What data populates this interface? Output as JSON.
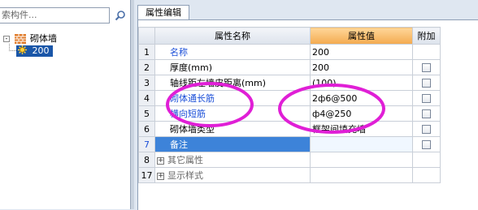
{
  "left_panel": {
    "search_placeholder": "索构件...",
    "tree": {
      "root_label": "砌体墙",
      "child_label": "200"
    }
  },
  "right_panel": {
    "tab_label": "属性编辑",
    "columns": {
      "num": "",
      "name": "属性名称",
      "value": "属性值",
      "extra": "附加"
    },
    "rows": [
      {
        "num": "1",
        "name": "名称",
        "value": "200",
        "style": "blue",
        "checkbox": false
      },
      {
        "num": "2",
        "name": "厚度(mm)",
        "value": "200",
        "style": "normal",
        "checkbox": true
      },
      {
        "num": "3",
        "name": "轴线距左墙皮距离(mm)",
        "value": "(100)",
        "style": "normal",
        "checkbox": true
      },
      {
        "num": "4",
        "name": "砌体通长筋",
        "value": "2ф6@500",
        "style": "blue",
        "checkbox": true
      },
      {
        "num": "5",
        "name": "横向短筋",
        "value": "ф4@250",
        "style": "blue",
        "checkbox": true
      },
      {
        "num": "6",
        "name": "砌体墙类型",
        "value": "框架间填充墙",
        "style": "normal",
        "checkbox": true
      },
      {
        "num": "7",
        "name": "备注",
        "value": "",
        "style": "selected",
        "checkbox": true
      },
      {
        "num": "8",
        "name": "其它属性",
        "value": "",
        "style": "group",
        "checkbox": false
      },
      {
        "num": "17",
        "name": "显示样式",
        "value": "",
        "style": "group",
        "checkbox": false
      }
    ]
  },
  "icons": {
    "search": "search-icon",
    "wall": "wall-icon",
    "gear": "gear-icon",
    "expand": "expand-plus-icon",
    "checkbox": "checkbox-icon"
  },
  "colors": {
    "accent_blue": "#1b4fd8",
    "selection": "#3d83d9",
    "value_header": "#f3aa4f",
    "annotation": "#e01fd6"
  }
}
